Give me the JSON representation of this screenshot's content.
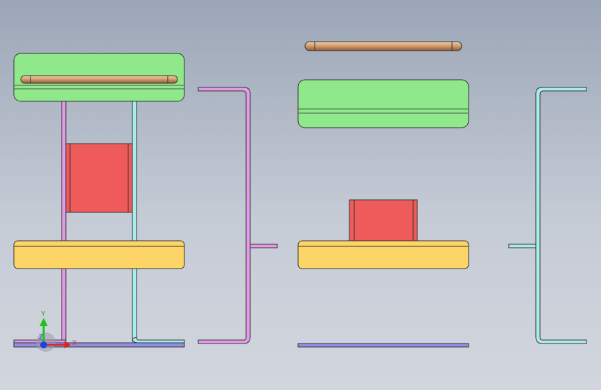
{
  "viewport": {
    "background_top": "#9ba6b7",
    "background_bottom": "#d2d6de"
  },
  "colors": {
    "green_part": "#8fe98a",
    "yellow_part": "#fdd567",
    "red_part": "#ef5b5b",
    "rod": "#d9a679",
    "magenta_bracket": "#e39be8",
    "cyan_bracket": "#a9ecec",
    "blue_base": "#8f8fe6",
    "edge": "#333333"
  },
  "triad": {
    "y_label": "Y",
    "x_label": "X",
    "z_label": "Z",
    "y_color": "#20c020",
    "x_color": "#e02020",
    "z_color": "#2040e0"
  }
}
